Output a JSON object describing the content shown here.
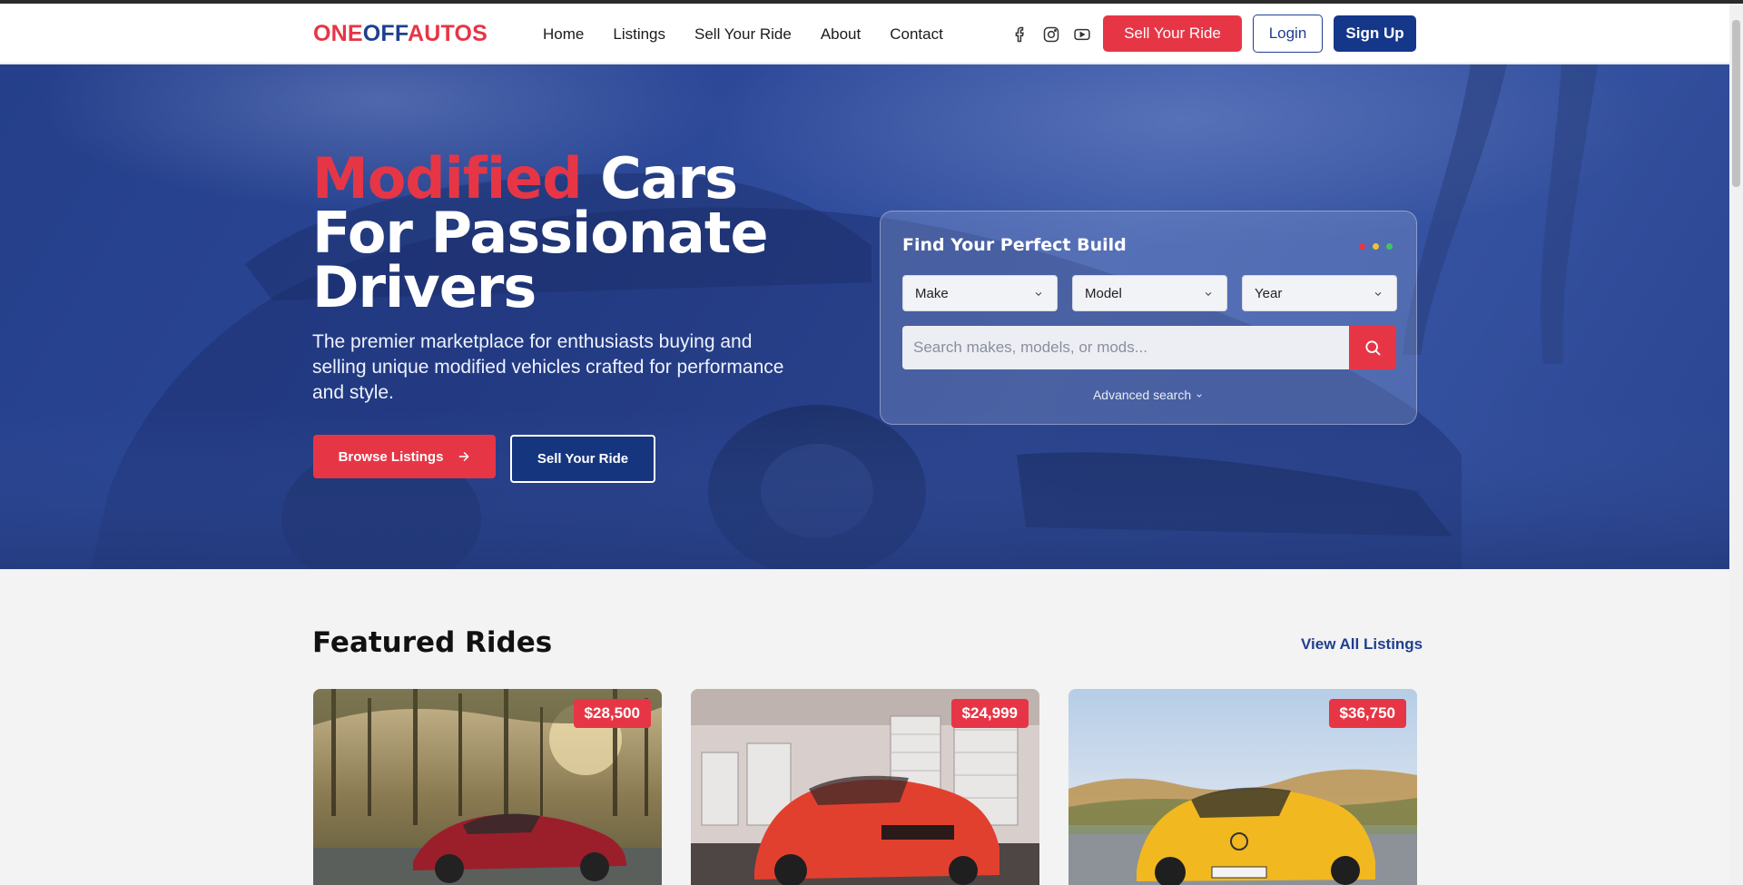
{
  "header": {
    "logo": {
      "part1": "ONE",
      "part2": "OFF",
      "part3": "AUTOS"
    },
    "nav": [
      "Home",
      "Listings",
      "Sell Your Ride",
      "About",
      "Contact"
    ],
    "social_icons": [
      "facebook-icon",
      "instagram-icon",
      "youtube-icon"
    ],
    "sell_label": "Sell Your Ride",
    "login_label": "Login",
    "signup_label": "Sign Up"
  },
  "hero": {
    "title_accent": "Modified",
    "title_rest1": "Cars",
    "title_line2": "For Passionate",
    "title_line3": "Drivers",
    "subtitle": "The premier marketplace for enthusiasts buying and selling unique modified vehicles crafted for performance and style.",
    "browse_label": "Browse Listings",
    "sell_label": "Sell Your Ride"
  },
  "search": {
    "title": "Find Your Perfect Build",
    "make": "Make",
    "model": "Model",
    "year": "Year",
    "placeholder": "Search makes, models, or mods...",
    "advanced": "Advanced search"
  },
  "featured": {
    "title": "Featured Rides",
    "view_all": "View All Listings",
    "cards": [
      {
        "price": "$28,500"
      },
      {
        "price": "$24,999"
      },
      {
        "price": "$36,750"
      }
    ]
  },
  "colors": {
    "accent": "#e63646",
    "brand": "#1f3f8f",
    "navy": "#15378a"
  }
}
